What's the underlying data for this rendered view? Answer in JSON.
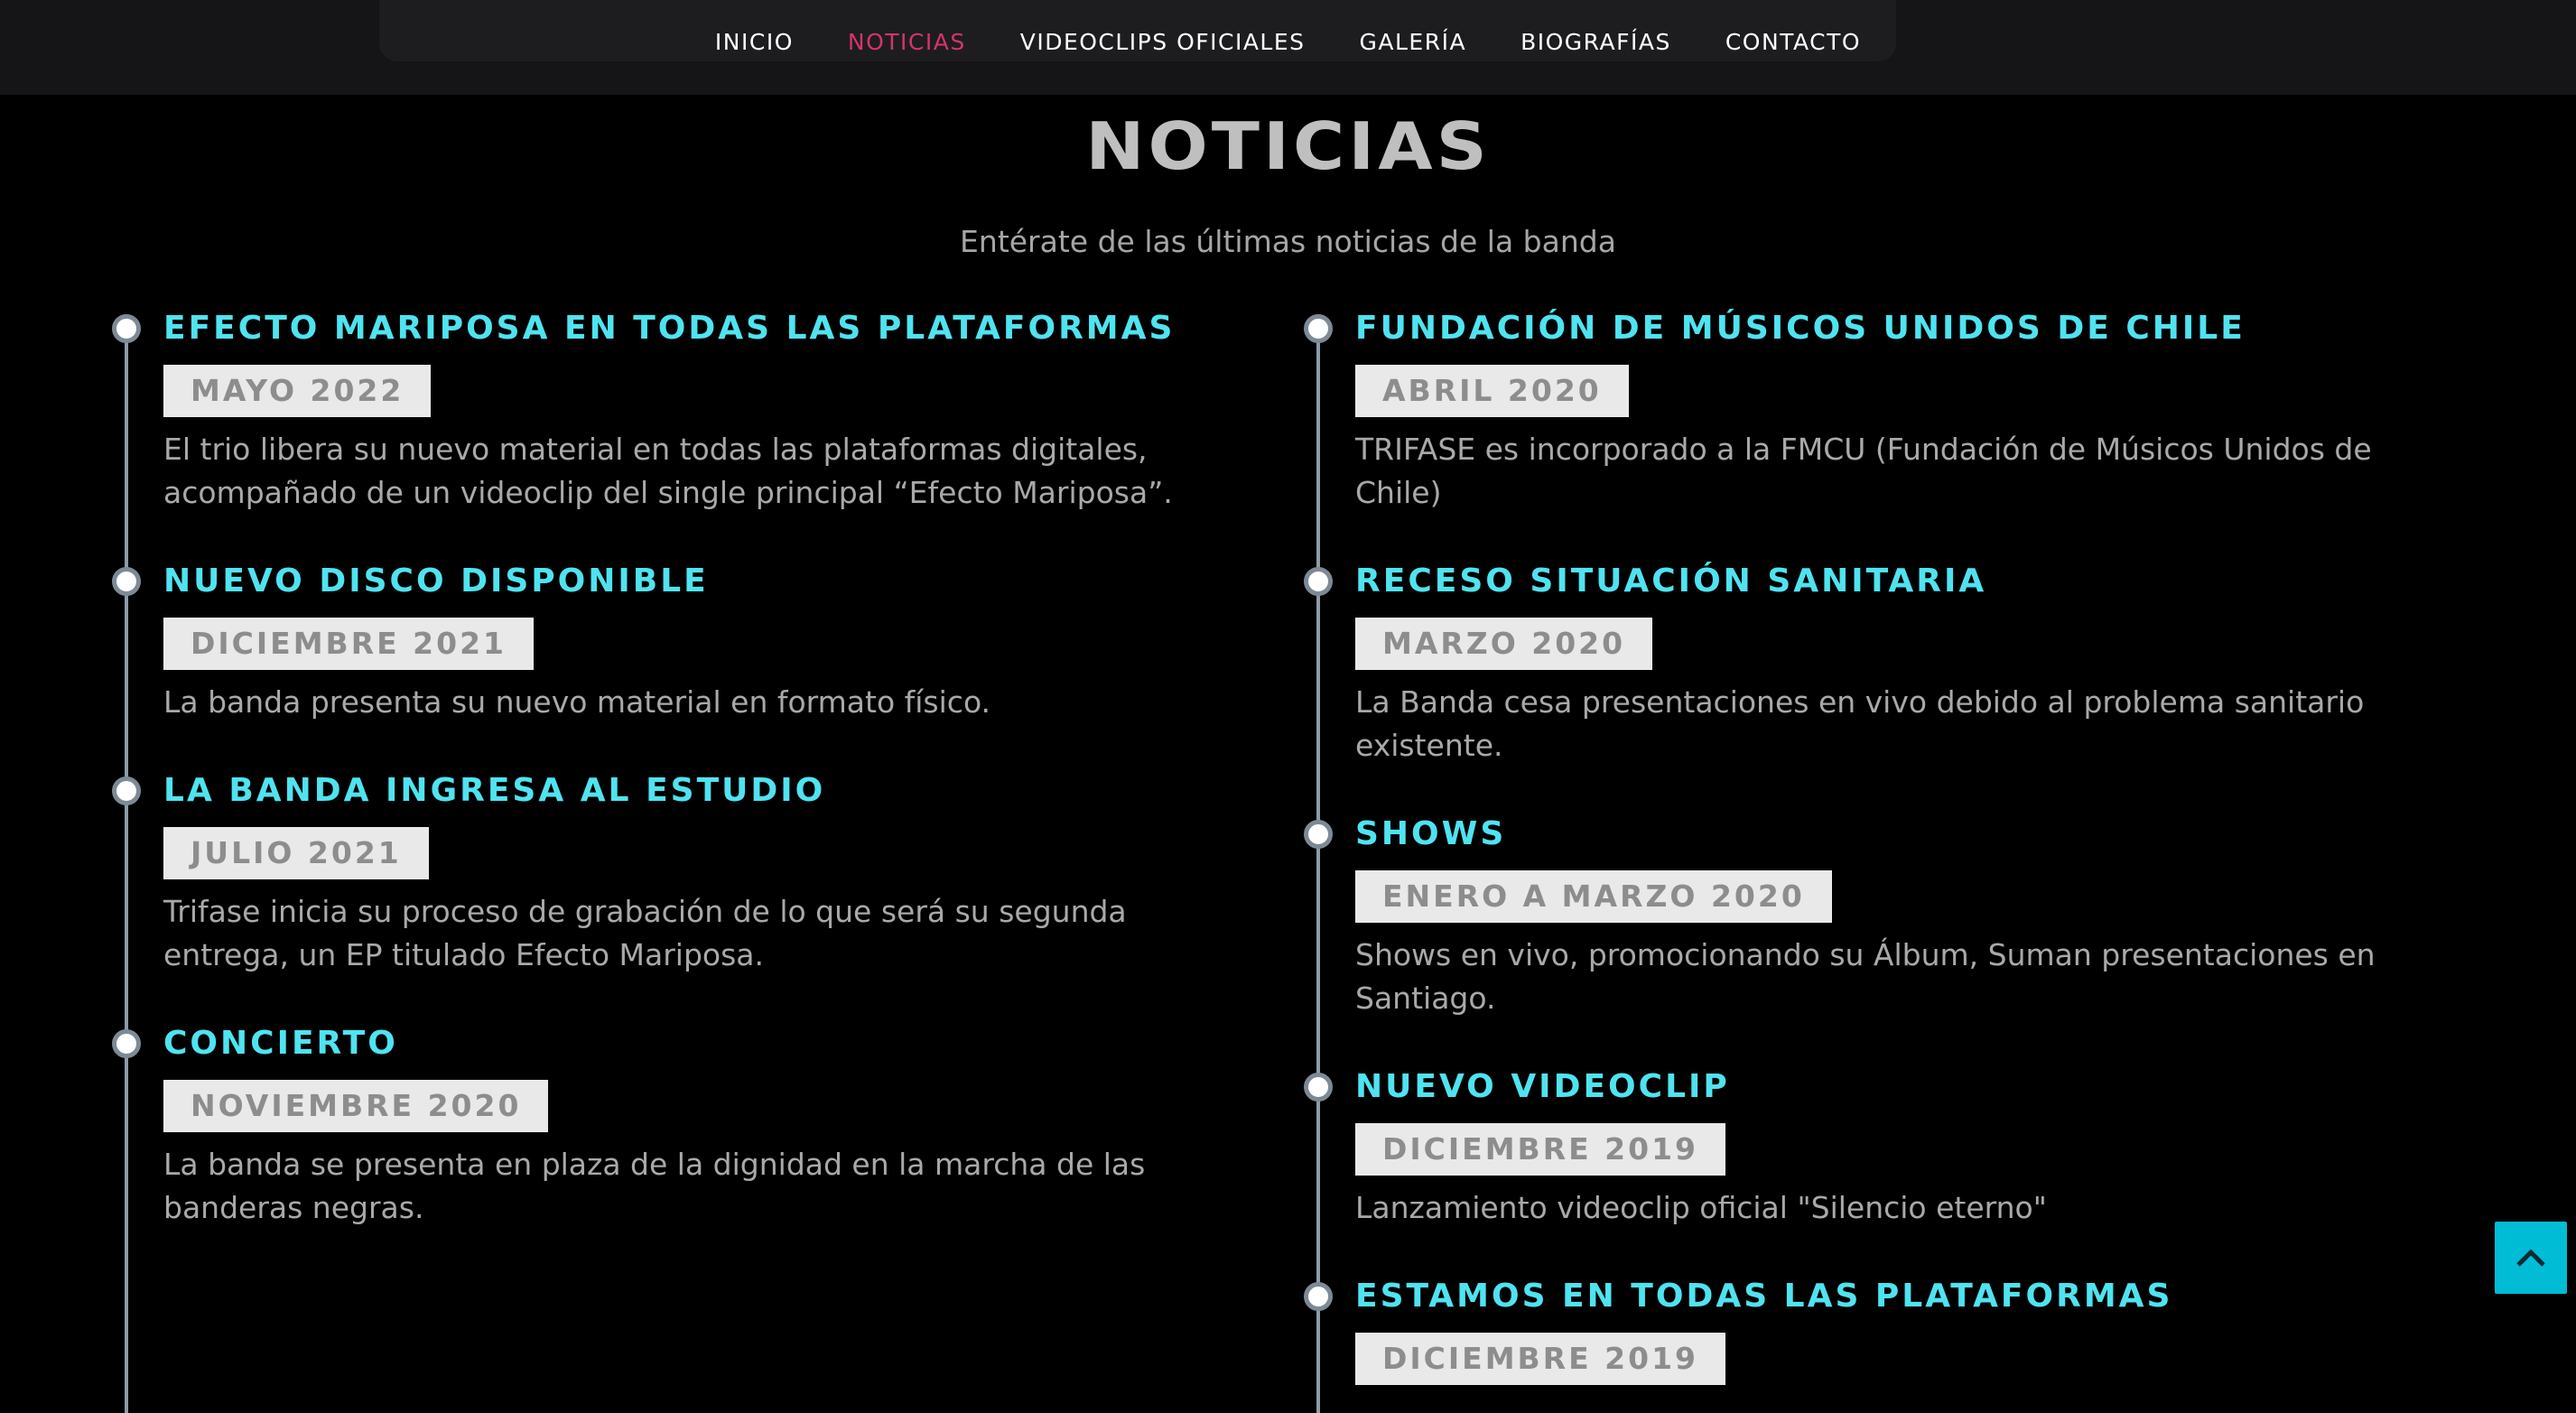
{
  "nav": {
    "items": [
      "INICIO",
      "NOTICIAS",
      "VIDEOCLIPS OFICIALES",
      "GALERÍA",
      "BIOGRAFÍAS",
      "CONTACTO"
    ]
  },
  "section": {
    "title": "NOTICIAS",
    "subtitle": "Entérate de las últimas noticias de la banda"
  },
  "left": [
    {
      "title": "EFECTO MARIPOSA EN TODAS LAS PLATAFORMAS",
      "date": "MAYO 2022",
      "text": "El trio libera su nuevo material en todas las plataformas digitales, acompañado de un videoclip del single principal “Efecto Mariposa”."
    },
    {
      "title": "NUEVO DISCO DISPONIBLE",
      "date": "DICIEMBRE 2021",
      "text": "La banda presenta su nuevo material en formato físico."
    },
    {
      "title": "LA BANDA INGRESA AL ESTUDIO",
      "date": "JULIO 2021",
      "text": "Trifase inicia su proceso de grabación de lo que será su segunda entrega, un EP titulado Efecto Mariposa."
    },
    {
      "title": "CONCIERTO",
      "date": "NOVIEMBRE 2020",
      "text": "La banda se presenta en plaza de la dignidad en la marcha de las banderas negras."
    }
  ],
  "right": [
    {
      "title": "FUNDACIÓN DE MÚSICOS UNIDOS DE CHILE",
      "date": "ABRIL 2020",
      "text": "TRIFASE es incorporado a la FMCU (Fundación de Músicos Unidos de Chile)"
    },
    {
      "title": "RECESO SITUACIÓN SANITARIA",
      "date": "MARZO 2020",
      "text": "La Banda cesa presentaciones en vivo debido al problema sanitario existente."
    },
    {
      "title": "SHOWS",
      "date": "ENERO A MARZO 2020",
      "text": "Shows en vivo, promocionando su Álbum, Suman presentaciones en Santiago."
    },
    {
      "title": "NUEVO VIDEOCLIP",
      "date": "DICIEMBRE 2019",
      "text": "Lanzamiento videoclip oficial \"Silencio eterno\""
    },
    {
      "title": "ESTAMOS EN TODAS LAS PLATAFORMAS",
      "date": "DICIEMBRE 2019",
      "text": ""
    }
  ],
  "colors": {
    "accent": "#d6336c",
    "title": "#4fe3f0",
    "backToTop": "#00bcd4"
  },
  "icons": {
    "back_to_top": "chevron-up-icon"
  }
}
